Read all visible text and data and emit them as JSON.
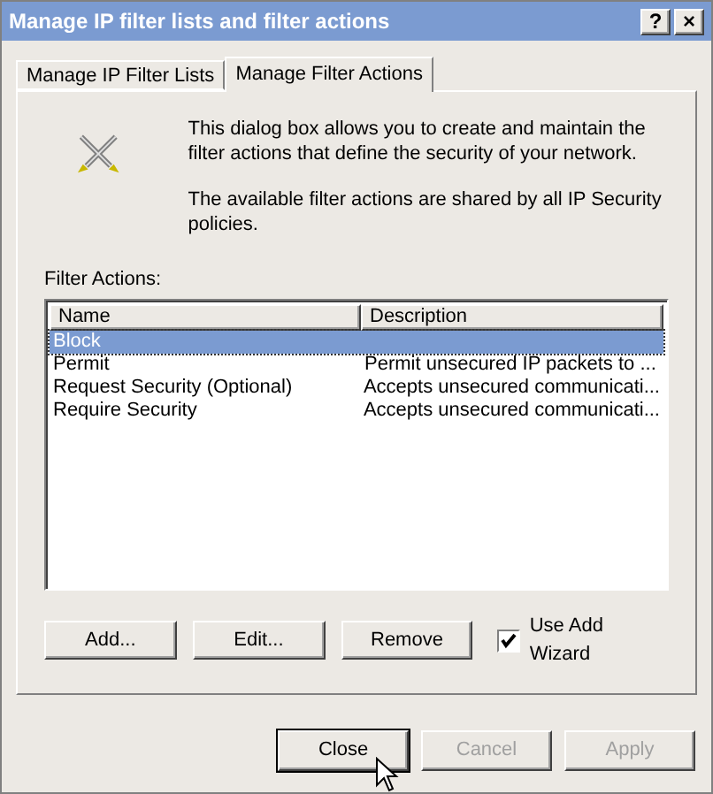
{
  "window": {
    "title": "Manage IP filter lists and filter actions",
    "title_buttons": [
      "?",
      "×"
    ]
  },
  "tabs": [
    {
      "label": "Manage IP Filter Lists",
      "selected": false
    },
    {
      "label": "Manage Filter Actions",
      "selected": true
    }
  ],
  "intro": [
    "This dialog box allows you to create and maintain the filter actions that define the security of your network.",
    "The available filter actions are shared by all IP Security policies."
  ],
  "list": {
    "label": "Filter Actions:",
    "columns": [
      "Name",
      "Description"
    ],
    "rows": [
      {
        "name": "Block",
        "description": "",
        "selected": true
      },
      {
        "name": "Permit",
        "description": "Permit unsecured IP packets to ...",
        "selected": false
      },
      {
        "name": "Request Security (Optional)",
        "description": "Accepts unsecured communicati...",
        "selected": false
      },
      {
        "name": "Require Security",
        "description": "Accepts unsecured communicati...",
        "selected": false
      }
    ]
  },
  "actions": [
    {
      "label": "Add..."
    },
    {
      "label": "Edit..."
    },
    {
      "label": "Remove"
    }
  ],
  "wizard": {
    "label": "Use Add Wizard",
    "checked": true
  },
  "buttons": [
    {
      "label": "Close",
      "disabled": false
    },
    {
      "label": "Cancel",
      "disabled": true
    },
    {
      "label": "Apply",
      "disabled": true
    }
  ]
}
